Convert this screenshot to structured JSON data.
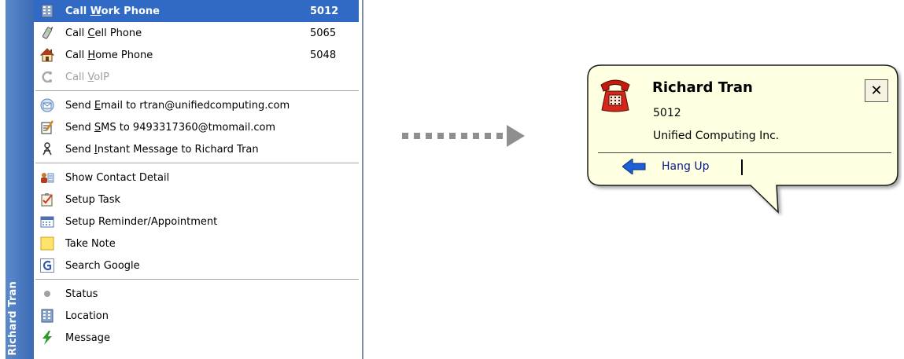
{
  "menu": {
    "strip_label": "Richard Tran",
    "items": [
      {
        "pre": "Call ",
        "u": "W",
        "post": "ork Phone",
        "number": "5012",
        "icon": "building-icon",
        "state": "selected"
      },
      {
        "pre": "Call ",
        "u": "C",
        "post": "ell Phone",
        "number": "5065",
        "icon": "cellphone-icon",
        "state": "normal"
      },
      {
        "pre": "Call ",
        "u": "H",
        "post": "ome Phone",
        "number": "5048",
        "icon": "house-icon",
        "state": "normal"
      },
      {
        "pre": "Call ",
        "u": "V",
        "post": "oIP",
        "number": "",
        "icon": "voip-icon",
        "state": "disabled"
      },
      {
        "pre": "Send ",
        "u": "E",
        "post": "mail to rtran@unifiedcomputing.com",
        "icon": "email-icon",
        "state": "normal"
      },
      {
        "pre": "Send ",
        "u": "S",
        "post": "MS to 9493317360@tmomail.com",
        "icon": "sms-icon",
        "state": "normal"
      },
      {
        "pre": "Send ",
        "u": "I",
        "post": "nstant Message to Richard Tran",
        "icon": "instant-message-icon",
        "state": "normal"
      },
      {
        "label": "Show Contact Detail",
        "icon": "contact-card-icon"
      },
      {
        "label": "Setup Task",
        "icon": "task-icon"
      },
      {
        "label": "Setup Reminder/Appointment",
        "icon": "calendar-icon"
      },
      {
        "label": "Take Note",
        "icon": "note-icon"
      },
      {
        "label": "Search Google",
        "icon": "google-icon"
      },
      {
        "label": "Status",
        "icon": "status-dot-icon"
      },
      {
        "label": "Location",
        "icon": "building-icon"
      },
      {
        "label": "Message",
        "icon": "lightning-icon"
      }
    ]
  },
  "callout": {
    "name": "Richard Tran",
    "number": "5012",
    "company": "Unified Computing Inc.",
    "close_label": "✕",
    "hangup_label": "Hang Up"
  },
  "colors": {
    "menu_strip": "#3c6bb5",
    "selection": "#316ac5",
    "callout_bg": "#ffffe1",
    "arrow": "#8f8f8f"
  }
}
